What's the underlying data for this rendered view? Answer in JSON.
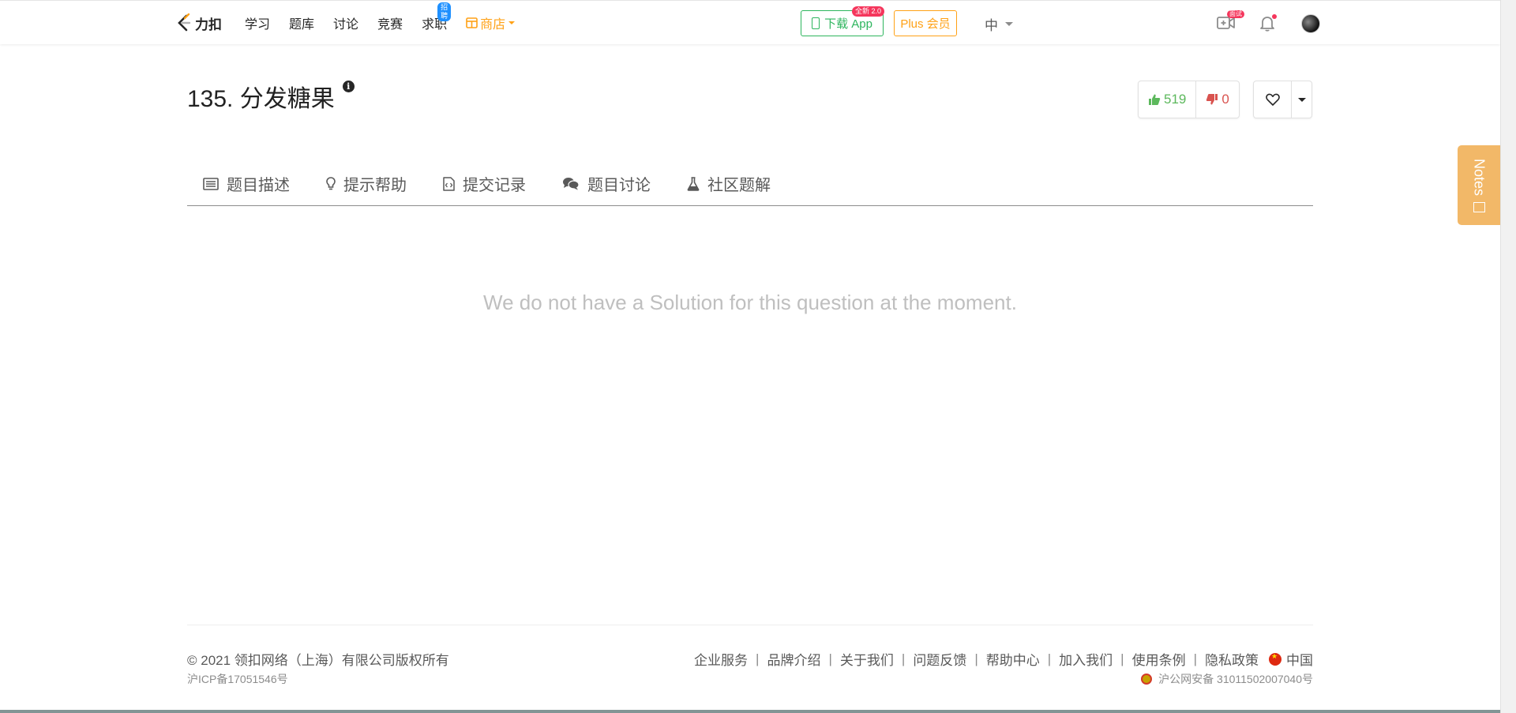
{
  "navbar": {
    "logo_text": "力扣",
    "links": [
      "学习",
      "题库",
      "讨论",
      "竞赛",
      "求职"
    ],
    "hire_badge": "招聘",
    "store_label": "商店",
    "download_app": "下载 App",
    "new_badge": "全新 2.0",
    "plus_member": "Plus 会员",
    "language": "中",
    "test_badge": "面试"
  },
  "problem": {
    "title": "135. 分发糖果",
    "likes": "519",
    "dislikes": "0"
  },
  "tabs": [
    "题目描述",
    "提示帮助",
    "提交记录",
    "题目讨论",
    "社区题解"
  ],
  "empty_message": "We do not have a Solution for this question at the moment.",
  "footer": {
    "copyright": "© 2021 领扣网络（上海）有限公司版权所有",
    "icp": "沪ICP备17051546号",
    "links": [
      "企业服务",
      "品牌介绍",
      "关于我们",
      "问题反馈",
      "帮助中心",
      "加入我们",
      "使用条例",
      "隐私政策"
    ],
    "region": "中国",
    "police_record": "沪公网安备 31011502007040号"
  },
  "notes_label": "Notes",
  "colors": {
    "accent_orange": "#ffa116",
    "green": "#2db55d",
    "like_green": "#5cb85c",
    "dislike_red": "#d9534f",
    "notes_bg": "#f2b868"
  }
}
